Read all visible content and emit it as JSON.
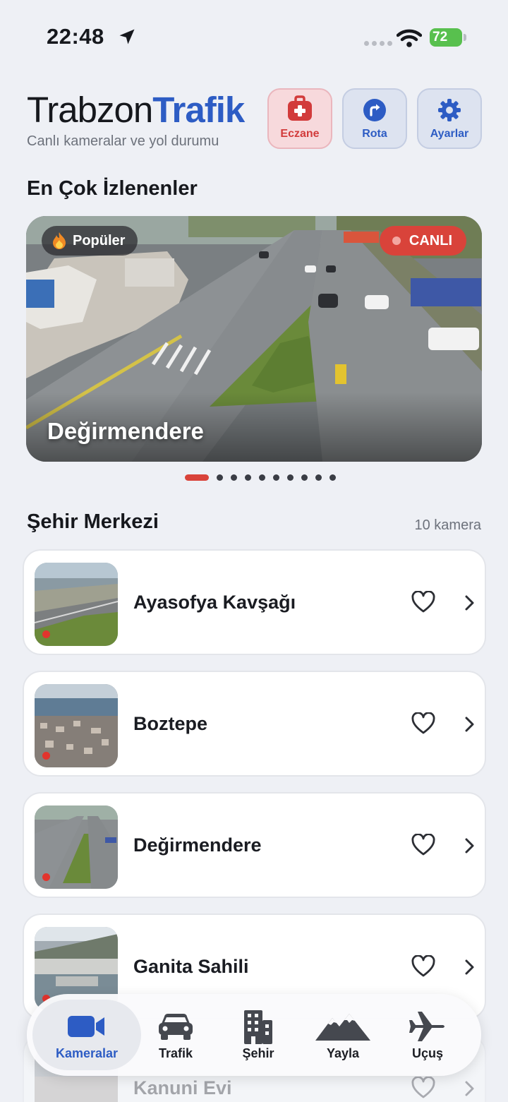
{
  "status": {
    "time": "22:48",
    "battery": "72"
  },
  "header": {
    "brand_light": "Trabzon",
    "brand_bold": "Trafik",
    "subtitle": "Canlı kameralar ve yol durumu"
  },
  "actions": [
    {
      "label": "Eczane",
      "icon": "first-aid-kit-icon",
      "color": "#d23b3b"
    },
    {
      "label": "Rota",
      "icon": "route-turn-icon",
      "color": "#2d5cc4"
    },
    {
      "label": "Ayarlar",
      "icon": "gear-icon",
      "color": "#2d5cc4"
    }
  ],
  "popular": {
    "title": "En Çok İzlenenler",
    "badge": "Popüler",
    "live_badge": "CANLI",
    "camera_name": "Değirmendere",
    "page_count": 10,
    "active_page": 1
  },
  "city_center": {
    "title": "Şehir Merkezi",
    "count": "10 kamera",
    "cameras": [
      {
        "name": "Ayasofya Kavşağı",
        "live": true
      },
      {
        "name": "Boztepe",
        "live": true
      },
      {
        "name": "Değirmendere",
        "live": true
      },
      {
        "name": "Ganita Sahili",
        "live": true
      },
      {
        "name": "Kanuni Evi",
        "live": true
      }
    ]
  },
  "tabbar": {
    "tabs": [
      {
        "label": "Kameralar",
        "icon": "video-camera-icon",
        "active": true
      },
      {
        "label": "Trafik",
        "icon": "car-icon",
        "active": false
      },
      {
        "label": "Şehir",
        "icon": "building-icon",
        "active": false
      },
      {
        "label": "Yayla",
        "icon": "mountain-icon",
        "active": false
      },
      {
        "label": "Uçuş",
        "icon": "airplane-icon",
        "active": false
      }
    ]
  },
  "colors": {
    "accent": "#2d5cc4",
    "live": "#d9433a",
    "background": "#eef0f5"
  }
}
